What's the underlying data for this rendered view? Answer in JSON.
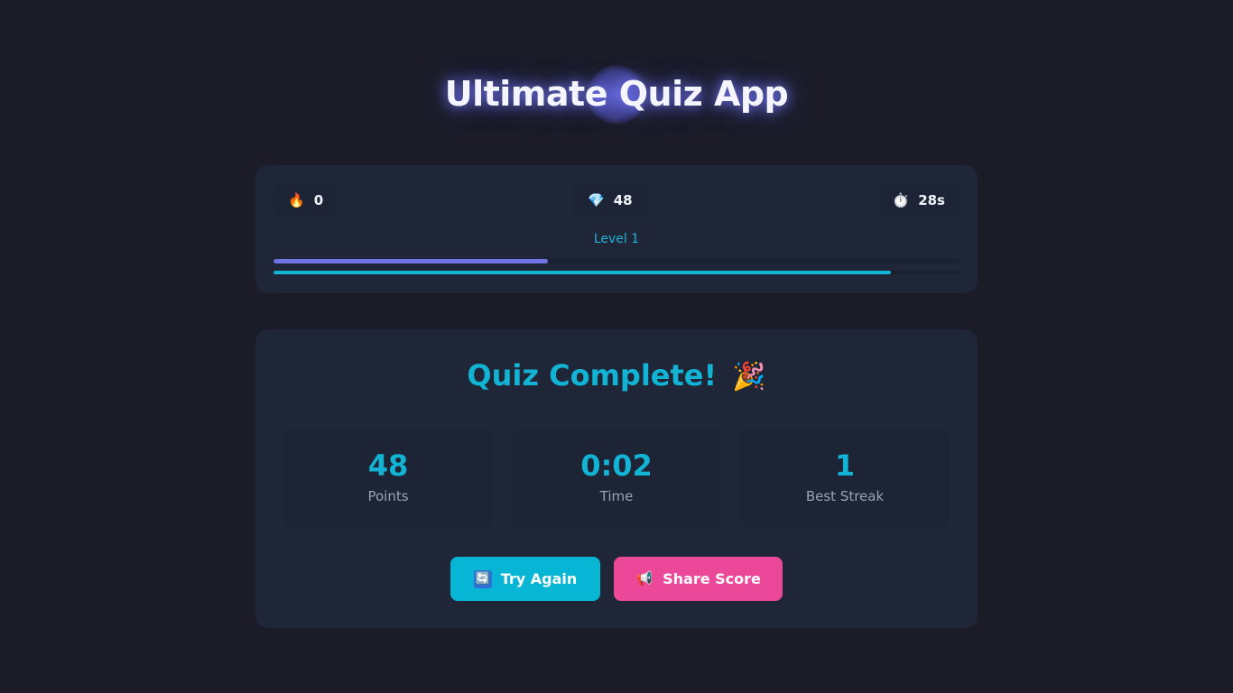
{
  "header": {
    "title": "Ultimate Quiz App"
  },
  "stats": {
    "streak": {
      "icon": "fire-icon",
      "glyph": "🔥",
      "value": "0"
    },
    "gems": {
      "icon": "gem-icon",
      "glyph": "💎",
      "value": "48"
    },
    "timer": {
      "icon": "stopwatch-icon",
      "glyph": "⏱️",
      "value": "28s"
    },
    "level_label": "Level 1",
    "level_progress_fraction": 0.4,
    "time_remaining_fraction": 0.9
  },
  "result": {
    "title": "Quiz Complete!",
    "title_emoji": "🎉",
    "boxes": [
      {
        "value": "48",
        "label": "Points"
      },
      {
        "value": "0:02",
        "label": "Time"
      },
      {
        "value": "1",
        "label": "Best Streak"
      }
    ],
    "buttons": {
      "try_again": {
        "icon": "refresh-icon",
        "glyph": "🔄",
        "label": "Try Again"
      },
      "share": {
        "icon": "megaphone-icon",
        "glyph": "📢",
        "label": "Share Score"
      }
    }
  },
  "colors": {
    "background": "#1b1c28",
    "card": "#1e2638",
    "accent": "#12b3d4",
    "progress": "#6e73e6",
    "share": "#ec4899"
  }
}
